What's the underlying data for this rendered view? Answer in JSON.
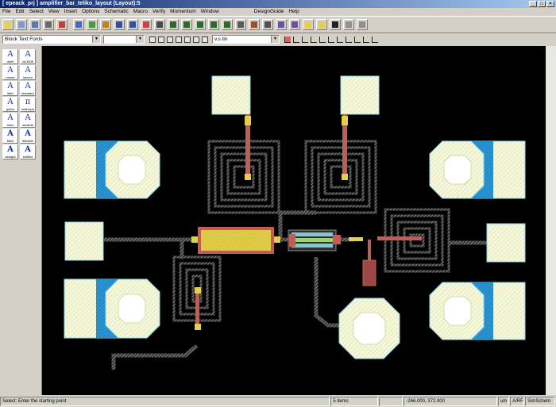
{
  "window": {
    "title": "[ epeack_prj ] amplifier_bar_teliko_layout (Layout):5",
    "buttons": [
      "_",
      "□",
      "×"
    ]
  },
  "menus": [
    "File",
    "Edit",
    "Select",
    "View",
    "Insert",
    "Options",
    "Schematic",
    "Macro",
    "Verify",
    "Momentum",
    "Window",
    "DesignGuide",
    "Help"
  ],
  "toolbar": {
    "row1_icons": [
      "new-file-icon",
      "open-file-icon",
      "save-icon",
      "print-icon",
      "layers-icon",
      "cut-icon",
      "copy-icon",
      "paste-icon",
      "undo-icon",
      "redo-icon",
      "move-icon",
      "align-icon",
      "zoom-icon",
      "zoom-in-icon",
      "zoom-out-icon",
      "zoom-area-icon",
      "zoom-fit-icon",
      "snap-icon",
      "port-icon",
      "ground-icon",
      "flip-icon",
      "mirror-icon",
      "rectangle-icon",
      "circle-icon",
      "text-icon",
      "push-icon",
      "pop-icon"
    ],
    "font_combo": "Block Text Fonts",
    "layer_combo": "",
    "row2_icons": [
      "polygon-icon",
      "circle-tool-icon",
      "ground-tool-icon",
      "component-icon",
      "bus-icon",
      "trace-icon",
      "pin-icon"
    ],
    "layer_select": "v,s tin",
    "row2_tools": [
      "insert-pin-icon",
      "insert-port-icon",
      "wire-icon",
      "wire-tee-icon",
      "wire-cross-icon",
      "wire-end-icon",
      "via-icon",
      "stub-icon",
      "taper-icon",
      "bend-icon",
      "more-icon"
    ]
  },
  "palette": [
    {
      "glyph": "A",
      "label": "dstr0"
    },
    {
      "glyph": "A",
      "label": "ioc300fl"
    },
    {
      "glyph": "A",
      "label": "roman"
    },
    {
      "glyph": "A",
      "label": "imcorn"
    },
    {
      "glyph": "A",
      "label": "italic"
    },
    {
      "glyph": "A",
      "label": "standard"
    },
    {
      "glyph": "A",
      "label": "gothic"
    },
    {
      "glyph": "π",
      "label": "mathcyrs"
    },
    {
      "glyph": "A",
      "label": "sans"
    },
    {
      "glyph": "A",
      "label": "sansbld"
    },
    {
      "glyph": "A",
      "label": "filled"
    },
    {
      "glyph": "A",
      "label": "filledbld"
    },
    {
      "glyph": "A",
      "label": "straight"
    },
    {
      "glyph": "A",
      "label": "shfilled"
    }
  ],
  "status": {
    "prompt": "Select: Enter the starting point",
    "items": "5 items",
    "layer": "",
    "coords": "-266.000, 372.000",
    "units": "um",
    "mode": "A/RF",
    "sim": "SimSchem"
  },
  "colors": {
    "canvas": "#000000",
    "pad_fill": "#f4f6d8",
    "pad_edge": "#8fd7f0",
    "via_blue": "#1e88c8",
    "inductor_trace": "#9a9a9a",
    "cap_fill": "#e6d24a",
    "res_fill": "#a84a48",
    "feed_line": "#b5625a"
  }
}
